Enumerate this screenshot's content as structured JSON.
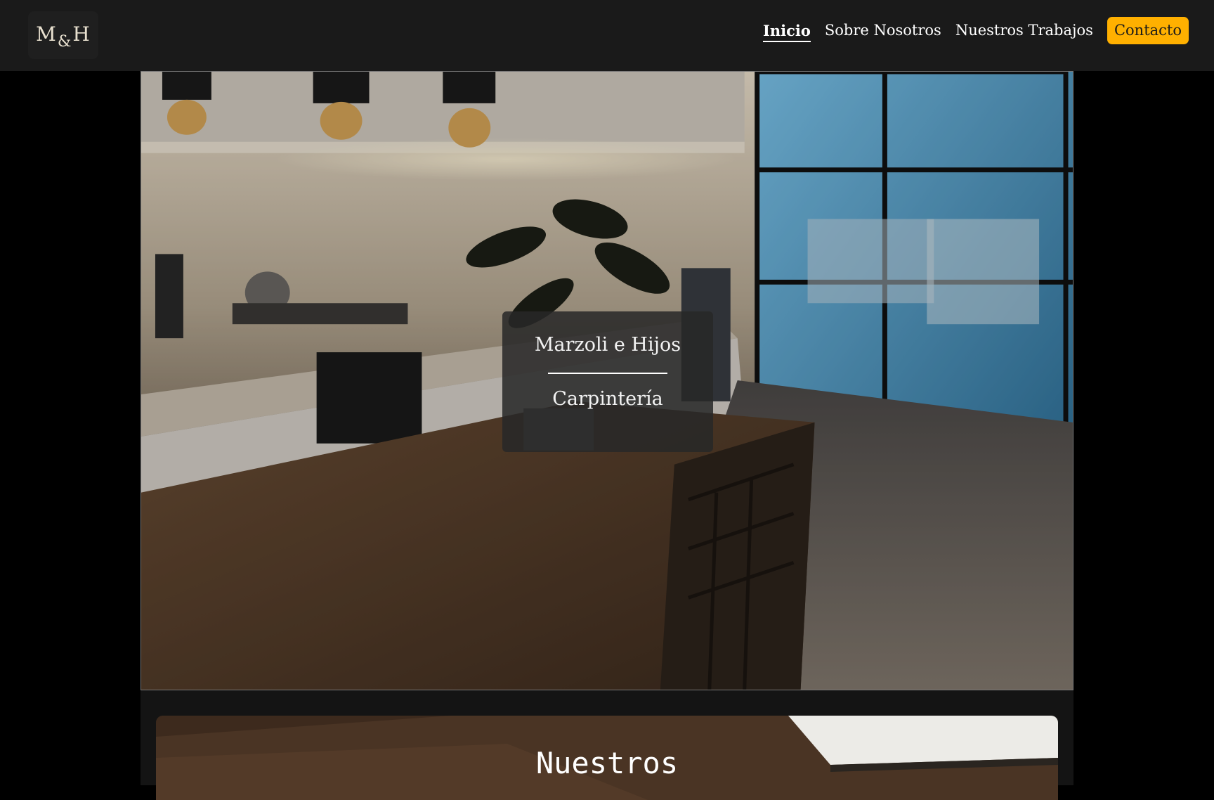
{
  "header": {
    "logo": {
      "left": "M",
      "amp": "&",
      "right": "H"
    },
    "nav": [
      {
        "label": "Inicio",
        "active": true
      },
      {
        "label": "Sobre Nosotros",
        "active": false
      },
      {
        "label": "Nuestros Trabajos",
        "active": false
      }
    ],
    "cta_label": "Contacto"
  },
  "hero": {
    "title": "Marzoli e Hijos",
    "subtitle": "Carpintería"
  },
  "works": {
    "title": "Nuestros"
  },
  "colors": {
    "header_bg": "#1a1a1a",
    "page_bg": "#000000",
    "accent": "#ffb000",
    "card_bg": "#282828"
  }
}
